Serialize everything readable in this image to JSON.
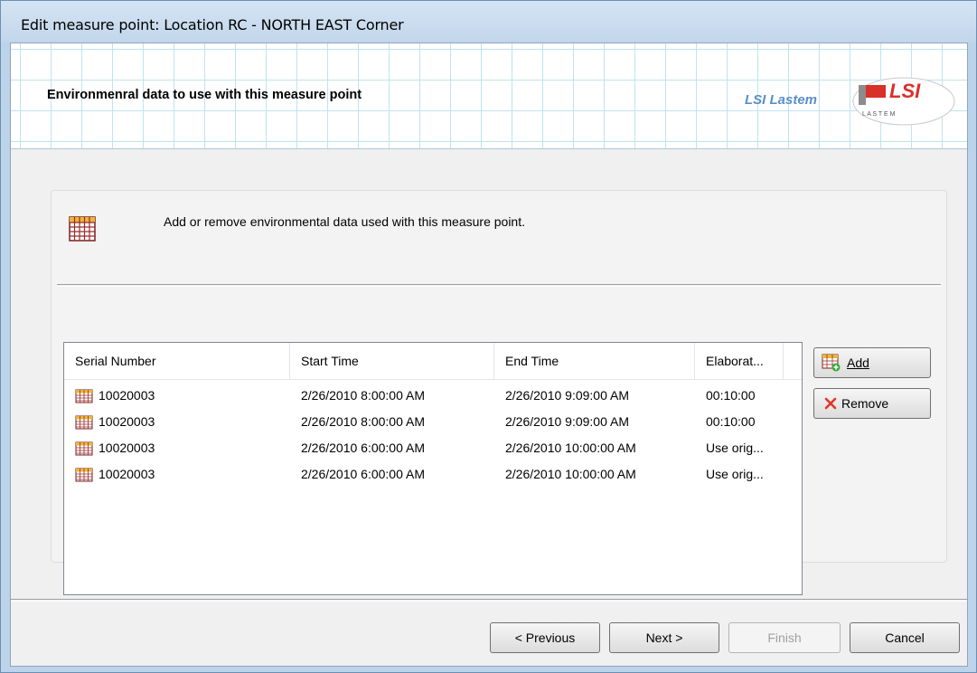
{
  "window": {
    "title": "Edit measure point: Location RC - NORTH EAST Corner"
  },
  "header": {
    "title": "Environmenral data to use with this measure point",
    "brand_text": "LSI Lastem",
    "logo_text": "LSI",
    "logo_subtext": "L A S T E M"
  },
  "group": {
    "description": "Add or remove environmental data used with this measure point."
  },
  "table": {
    "columns": [
      "Serial Number",
      "Start Time",
      "End Time",
      "Elaborat..."
    ],
    "rows": [
      {
        "serial": "10020003",
        "start": "2/26/2010 8:00:00 AM",
        "end": "2/26/2010 9:09:00 AM",
        "elaboration": "00:10:00"
      },
      {
        "serial": "10020003",
        "start": "2/26/2010 8:00:00 AM",
        "end": "2/26/2010 9:09:00 AM",
        "elaboration": "00:10:00"
      },
      {
        "serial": "10020003",
        "start": "2/26/2010 6:00:00 AM",
        "end": "2/26/2010 10:00:00 AM",
        "elaboration": "Use orig..."
      },
      {
        "serial": "10020003",
        "start": "2/26/2010 6:00:00 AM",
        "end": "2/26/2010 10:00:00 AM",
        "elaboration": "Use orig..."
      }
    ]
  },
  "side_buttons": {
    "add_label": "Add",
    "remove_label": "Remove"
  },
  "nav": {
    "previous": "< Previous",
    "next": "Next >",
    "finish": "Finish",
    "cancel": "Cancel"
  },
  "icons": {
    "table_icon": "grid-table-icon",
    "add_icon": "table-add-icon",
    "remove_icon": "red-x-icon"
  },
  "colors": {
    "brand_blue": "#5b8fc7",
    "logo_red": "#d8312a",
    "remove_red": "#e0342b",
    "add_green": "#3aa83a"
  }
}
